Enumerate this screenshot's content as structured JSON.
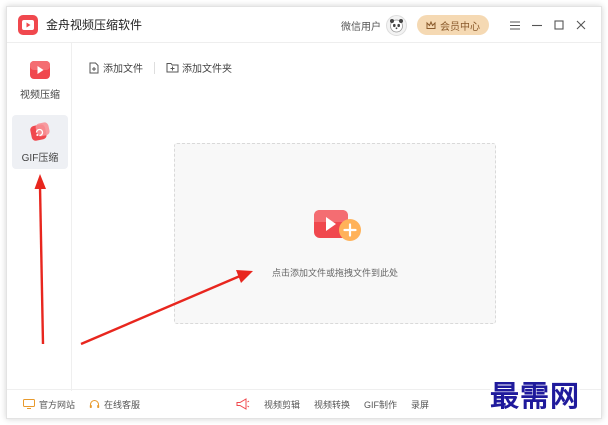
{
  "app": {
    "title": "金舟视频压缩软件"
  },
  "header": {
    "user_name": "微信用户",
    "vip_label": "会员中心"
  },
  "sidebar": {
    "items": [
      {
        "label": "视频压缩",
        "active": false
      },
      {
        "label": "GIF压缩",
        "active": true
      }
    ]
  },
  "toolbar": {
    "add_file": "添加文件",
    "add_folder": "添加文件夹"
  },
  "dropzone": {
    "hint": "点击添加文件或拖拽文件到此处"
  },
  "footer": {
    "website": "官方网站",
    "support": "在线客服",
    "links": [
      "视频剪辑",
      "视频转换",
      "GIF制作",
      "录屏"
    ]
  },
  "watermark": "最需网",
  "colors": {
    "brand_red": "#f0484e",
    "vip_gold": "#f5d9b3",
    "annotation_arrow": "#e8261e",
    "watermark": "#1f1a9c"
  }
}
